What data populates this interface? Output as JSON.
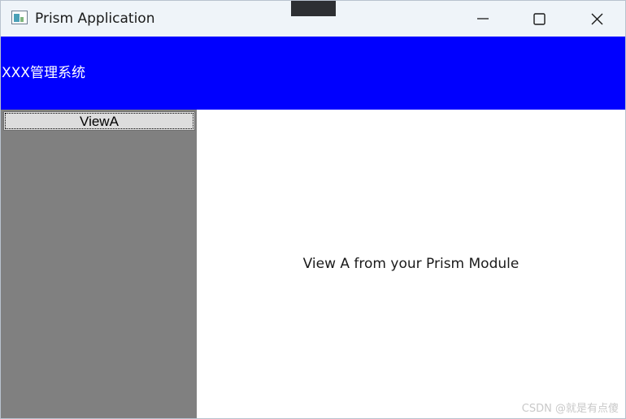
{
  "window": {
    "title": "Prism Application",
    "icon": "app-window-icon",
    "controls": {
      "minimize_icon": "minimize-icon",
      "maximize_icon": "maximize-icon",
      "close_icon": "close-icon"
    }
  },
  "header": {
    "title": "XXX管理系统",
    "background_color": "#0000ff"
  },
  "sidebar": {
    "background_color": "#808080",
    "items": [
      {
        "label": "ViewA"
      }
    ]
  },
  "content": {
    "text": "View A from your Prism Module"
  },
  "watermark": "CSDN @就是有点傻"
}
